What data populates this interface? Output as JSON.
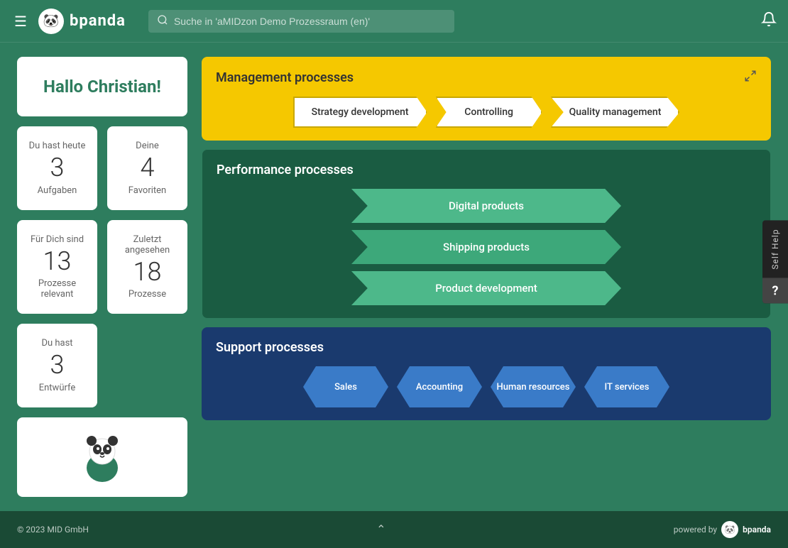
{
  "header": {
    "logo_text": "bpanda",
    "search_placeholder": "Suche in 'aMIDzon Demo Prozessraum (en)'"
  },
  "greeting": {
    "text": "Hallo Christian!"
  },
  "stats": {
    "today_label": "Du hast heute",
    "today_count": "3",
    "today_sublabel": "Aufgaben",
    "favorites_label": "Deine",
    "favorites_count": "4",
    "favorites_sublabel": "Favoriten",
    "relevant_label": "Für Dich sind",
    "relevant_count": "13",
    "relevant_sublabel": "Prozesse relevant",
    "recent_label": "Zuletzt angesehen",
    "recent_count": "18",
    "recent_sublabel": "Prozesse",
    "drafts_label": "Du hast",
    "drafts_count": "3",
    "drafts_sublabel": "Entwürfe"
  },
  "management": {
    "title": "Management processes",
    "items": [
      {
        "label": "Strategy development"
      },
      {
        "label": "Controlling"
      },
      {
        "label": "Quality management"
      }
    ]
  },
  "performance": {
    "title": "Performance processes",
    "items": [
      {
        "label": "Digital products"
      },
      {
        "label": "Shipping products"
      },
      {
        "label": "Product development"
      }
    ]
  },
  "support": {
    "title": "Support processes",
    "items": [
      {
        "label": "Sales"
      },
      {
        "label": "Accounting"
      },
      {
        "label": "Human resources"
      },
      {
        "label": "IT services"
      }
    ]
  },
  "self_help": {
    "label": "Self Help",
    "icon": "?"
  },
  "footer": {
    "copyright": "© 2023 MID GmbH",
    "powered_by": "powered by",
    "brand": "bpanda"
  }
}
